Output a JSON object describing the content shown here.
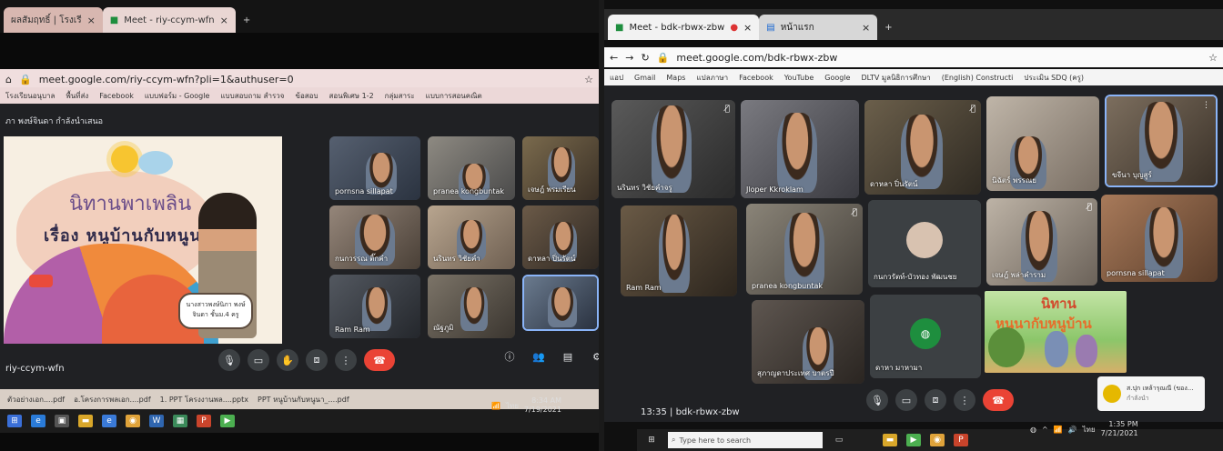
{
  "left": {
    "tabs": [
      {
        "label": "ผลสัมฤทธิ์ | โรงเรี",
        "active": false
      },
      {
        "label": "Meet - riy-ccym-wfn",
        "active": true
      }
    ],
    "url": "meet.google.com/riy-ccym-wfn?pli=1&authuser=0",
    "bookmarks": [
      "โรงเรียนอนุบาล",
      "พื้นที่ส่ง",
      "Facebook",
      "แบบฟอร์ม - Google",
      "แบบสอบถาม สำรวจ",
      "ข้อสอบ",
      "สอนพิเศษ 1-2",
      "กลุ่มสาระ",
      "แบบการสอนคณิต"
    ],
    "presenter_bar": "ภา พงษ์จินดา กำลังนำเสนอ",
    "slide": {
      "title1": "นิทานพาเพลิน",
      "title2": "เรื่อง    หนูบ้านกับหนูนา",
      "caption": "นางสาวพงษ์นิภา พงษ์จินดา ชั้นม.4 ครู"
    },
    "participants": [
      {
        "name": "pornsna sillapat"
      },
      {
        "name": "pranea kongbuntak"
      },
      {
        "name": "เจษฎ์ พรมเรียน"
      },
      {
        "name": "กนกวรรณ ติ๊กคำ"
      },
      {
        "name": "นรินทร วิชัยคำ"
      },
      {
        "name": "ดาหลา ปิ่นรัตน์"
      },
      {
        "name": "Ram Ram"
      },
      {
        "name": "ณัฐภูมิ"
      },
      {
        "name": ""
      }
    ],
    "meeting_code": "riy-ccym-wfn",
    "taskbar_files": [
      "ตัวอย่างเอก....pdf",
      "อ.โครงการพลเอก....pdf",
      "1. PPT โครงงานพล....pptx",
      "PPT หนูบ้านกับหนูนา_....pdf"
    ],
    "time": "8:34 AM",
    "date": "7/19/2021",
    "lang": "ไทย"
  },
  "right": {
    "tabs": [
      {
        "label": "Meet - bdk-rbwx-zbw",
        "active": true
      },
      {
        "label": "หน้าแรก",
        "active": false
      }
    ],
    "url": "meet.google.com/bdk-rbwx-zbw",
    "bookmarks": [
      "แอป",
      "Gmail",
      "Maps",
      "แปลภาษา",
      "Facebook",
      "YouTube",
      "Google",
      "DLTV มูลนิธิการศึกษา",
      "(English) Constructi",
      "ประเมิน SDQ (ครู)"
    ],
    "participants": [
      {
        "name": "นรินทร วิชัยคำจรู",
        "muted": true
      },
      {
        "name": "Jloper Kkroklam",
        "muted": false
      },
      {
        "name": "ดาหลา ปิ่นรัตน์",
        "muted": true
      },
      {
        "name": "นิฉัตร์ พรรณย",
        "muted": false
      },
      {
        "name": "ขจีนา บุญสูร์",
        "muted": false
      },
      {
        "name": "Ram Ram",
        "muted": false
      },
      {
        "name": "pranea kongbuntak",
        "muted": true
      },
      {
        "name": "กนกวรัตท์-บัวทอง พัฒนชย",
        "muted": false
      },
      {
        "name": "เจษฎ์ พล่าคำราม",
        "muted": true
      },
      {
        "name": "pornsna sillapat",
        "muted": false
      },
      {
        "name": "สุภาญดาประเทศ บาตรปี",
        "muted": false
      },
      {
        "name": "ดาหา มาหามา",
        "muted": false
      }
    ],
    "book": {
      "t1": "นิทาน",
      "t2": "หนูนากับหนูบ้าน"
    },
    "bottom_time": "13:35",
    "meeting_code": "bdk-rbwx-zbw",
    "notification": {
      "title": "ส.ปุก เหล้ารุณณี (ของ...",
      "sub": "กำลังนำ"
    },
    "search_placeholder": "Type here to search",
    "time": "1:35 PM",
    "date": "7/21/2021",
    "lang": "ไทย"
  }
}
